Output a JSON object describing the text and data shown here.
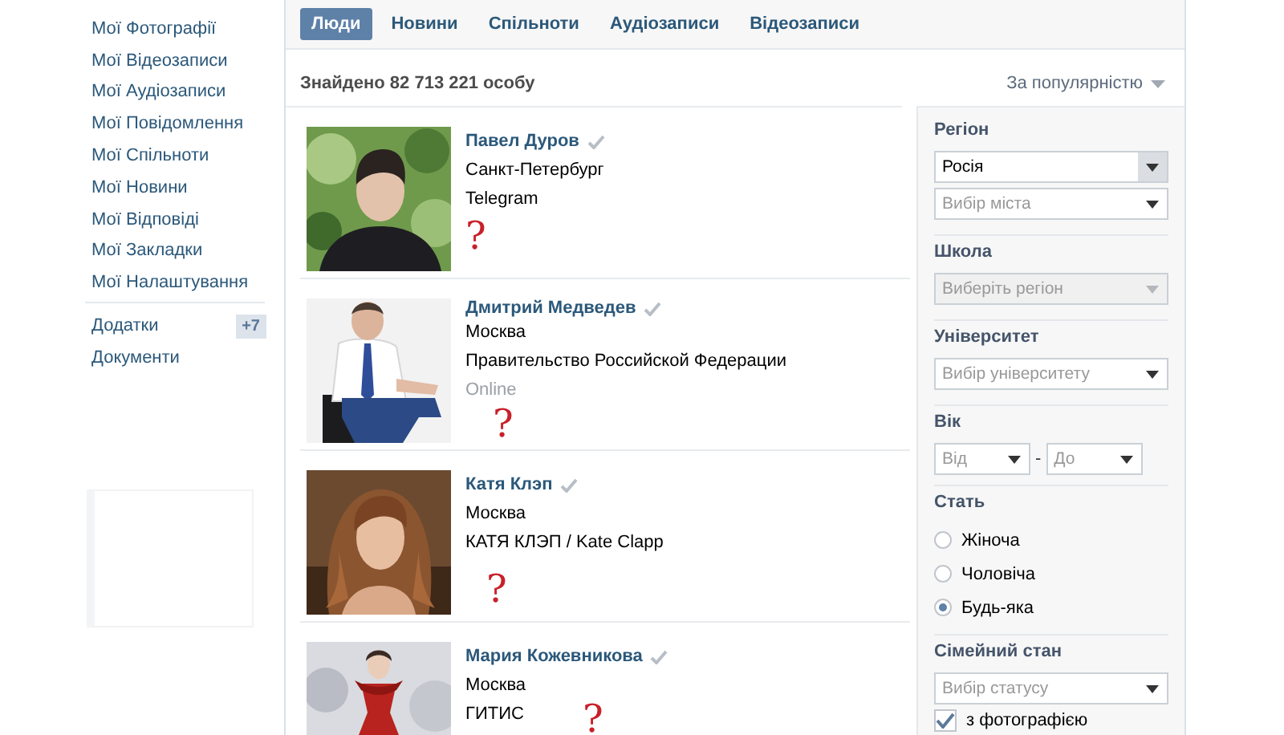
{
  "sidebar": {
    "items": [
      {
        "label": "Мої Фотографії"
      },
      {
        "label": "Мої Відеозаписи"
      },
      {
        "label": "Мої Аудіозаписи"
      },
      {
        "label": "Мої Повідомлення"
      },
      {
        "label": "Мої Спільноти"
      },
      {
        "label": "Мої Новини"
      },
      {
        "label": "Мої Відповіді"
      },
      {
        "label": "Мої Закладки"
      },
      {
        "label": "Мої Налаштування"
      },
      {
        "label": "Додатки",
        "badge": "+7",
        "separated": true
      },
      {
        "label": "Документи"
      }
    ]
  },
  "tabs": [
    {
      "label": "Люди",
      "selected": true
    },
    {
      "label": "Новини",
      "selected": false
    },
    {
      "label": "Спільноти",
      "selected": false
    },
    {
      "label": "Аудіозаписи",
      "selected": false
    },
    {
      "label": "Відеозаписи",
      "selected": false
    }
  ],
  "results": {
    "count": "Знайдено 82 713 221 особу",
    "sort": "За популярністю",
    "people": [
      {
        "photo": {
          "kind": "picture"
        },
        "name": "Павел Дуров",
        "verified": true,
        "lines": [
          {
            "kind": "info",
            "text": "Санкт-Петербург"
          },
          {
            "kind": "info",
            "text": "Telegram"
          }
        ],
        "annotation": "?"
      },
      {
        "photo": {
          "kind": "picture"
        },
        "name": "Дмитрий Медведев",
        "verified": true,
        "lines": [
          {
            "kind": "info",
            "text": "Москва"
          },
          {
            "kind": "info",
            "text": "Правительство Российской Федерации"
          },
          {
            "kind": "status",
            "text": "Online"
          }
        ],
        "annotation": "?"
      },
      {
        "photo": {
          "kind": "picture"
        },
        "name": "Катя Клэп",
        "verified": true,
        "lines": [
          {
            "kind": "info",
            "text": "Москва"
          },
          {
            "kind": "info",
            "text": "КАТЯ КЛЭП / Kate Clapp"
          }
        ],
        "annotation": "?"
      },
      {
        "photo": {
          "kind": "picture"
        },
        "name": "Мария Кожевникова",
        "verified": true,
        "lines": [
          {
            "kind": "info",
            "text": "Москва"
          },
          {
            "kind": "info",
            "text": "ГИТИС"
          }
        ],
        "annotation": "?"
      }
    ]
  },
  "filters": [
    {
      "title": "Регіон",
      "controls": [
        {
          "kind": "select",
          "value": "Росія",
          "disabled": false
        },
        {
          "kind": "select",
          "placeholder": "Вибір міста",
          "disabled": false
        }
      ]
    },
    {
      "title": "Школа",
      "controls": [
        {
          "kind": "select",
          "placeholder": "Виберіть регіон",
          "disabled": true
        }
      ]
    },
    {
      "title": "Університет",
      "controls": [
        {
          "kind": "select",
          "placeholder": "Вибір університету",
          "disabled": false
        }
      ]
    },
    {
      "title": "Вік",
      "controls": [
        {
          "kind": "range",
          "from": "Від",
          "separator": "-",
          "to": "До"
        }
      ]
    },
    {
      "title": "Стать",
      "controls": [
        {
          "kind": "radio",
          "options": [
            {
              "label": "Жіноча",
              "selected": false
            },
            {
              "label": "Чоловіча",
              "selected": false
            },
            {
              "label": "Будь-яка",
              "selected": true
            }
          ]
        }
      ]
    },
    {
      "title": "Сімейний стан",
      "controls": [
        {
          "kind": "select",
          "placeholder": "Вибір статусу",
          "disabled": false
        },
        {
          "kind": "checkbox",
          "label": "з фотографією",
          "checked": true
        }
      ]
    }
  ]
}
